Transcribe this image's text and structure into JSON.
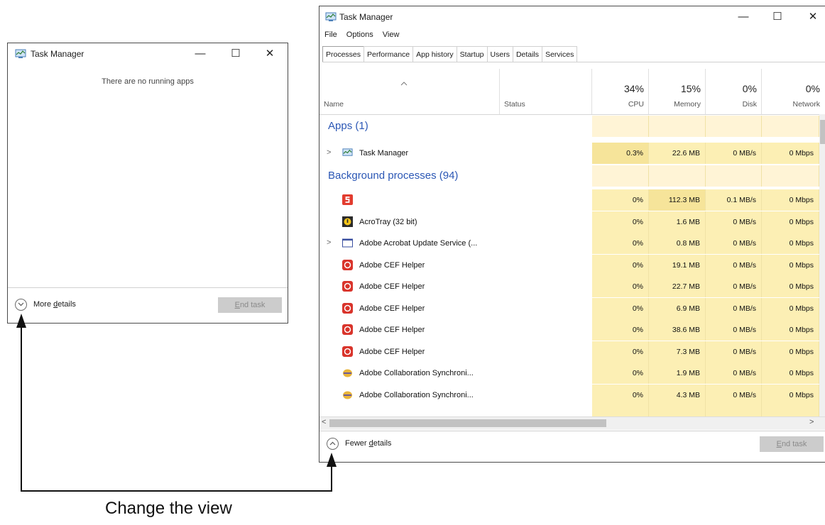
{
  "small_window": {
    "title": "Task Manager",
    "minimize": "—",
    "maximize": "☐",
    "close": "✕",
    "message": "There are no running apps",
    "more_details_prefix": "More ",
    "more_details_accel": "d",
    "more_details_suffix": "etails",
    "end_task_accel": "E",
    "end_task_suffix": "nd task"
  },
  "large_window": {
    "title": "Task Manager",
    "minimize": "—",
    "maximize": "☐",
    "close": "✕",
    "menu": [
      "File",
      "Options",
      "View"
    ],
    "tabs": [
      "Processes",
      "Performance",
      "App history",
      "Startup",
      "Users",
      "Details",
      "Services"
    ],
    "columns": {
      "name": "Name",
      "status": "Status",
      "cpu_pct": "34%",
      "cpu": "CPU",
      "memory_pct": "15%",
      "memory": "Memory",
      "disk_pct": "0%",
      "disk": "Disk",
      "network_pct": "0%",
      "network": "Network"
    },
    "apps_group": "Apps (1)",
    "bg_group": "Background processes (94)",
    "rows": [
      {
        "name": "Task Manager",
        "cpu": "0.3%",
        "memory": "22.6 MB",
        "disk": "0 MB/s",
        "network": "0 Mbps",
        "expand": ">",
        "icon": "task-manager-icon"
      },
      {
        "name": "",
        "cpu": "0%",
        "memory": "112.3 MB",
        "disk": "0.1 MB/s",
        "network": "0 Mbps",
        "expand": "",
        "icon": "red-s-icon"
      },
      {
        "name": "AcroTray (32 bit)",
        "cpu": "0%",
        "memory": "1.6 MB",
        "disk": "0 MB/s",
        "network": "0 Mbps",
        "expand": "",
        "icon": "acrotray-icon"
      },
      {
        "name": "Adobe Acrobat Update Service (...",
        "cpu": "0%",
        "memory": "0.8 MB",
        "disk": "0 MB/s",
        "network": "0 Mbps",
        "expand": ">",
        "icon": "service-window-icon"
      },
      {
        "name": "Adobe CEF Helper",
        "cpu": "0%",
        "memory": "19.1 MB",
        "disk": "0 MB/s",
        "network": "0 Mbps",
        "expand": "",
        "icon": "adobe-cef-icon"
      },
      {
        "name": "Adobe CEF Helper",
        "cpu": "0%",
        "memory": "22.7 MB",
        "disk": "0 MB/s",
        "network": "0 Mbps",
        "expand": "",
        "icon": "adobe-cef-icon"
      },
      {
        "name": "Adobe CEF Helper",
        "cpu": "0%",
        "memory": "6.9 MB",
        "disk": "0 MB/s",
        "network": "0 Mbps",
        "expand": "",
        "icon": "adobe-cef-icon"
      },
      {
        "name": "Adobe CEF Helper",
        "cpu": "0%",
        "memory": "38.6 MB",
        "disk": "0 MB/s",
        "network": "0 Mbps",
        "expand": "",
        "icon": "adobe-cef-icon"
      },
      {
        "name": "Adobe CEF Helper",
        "cpu": "0%",
        "memory": "7.3 MB",
        "disk": "0 MB/s",
        "network": "0 Mbps",
        "expand": "",
        "icon": "adobe-cef-icon"
      },
      {
        "name": "Adobe Collaboration Synchroni...",
        "cpu": "0%",
        "memory": "1.9 MB",
        "disk": "0 MB/s",
        "network": "0 Mbps",
        "expand": "",
        "icon": "adobe-sync-icon"
      },
      {
        "name": "Adobe Collaboration Synchroni...",
        "cpu": "0%",
        "memory": "4.3 MB",
        "disk": "0 MB/s",
        "network": "0 Mbps",
        "expand": "",
        "icon": "adobe-sync-icon"
      }
    ],
    "fewer_details_prefix": "Fewer ",
    "fewer_details_accel": "d",
    "fewer_details_suffix": "etails",
    "end_task_accel": "E",
    "end_task_suffix": "nd task",
    "scroll_left": "<",
    "scroll_right": ">"
  },
  "caption": "Change the view",
  "colors": {
    "heat_light": "#fff4d6",
    "heat_medium": "#fcefb4",
    "heat_strong": "#f6e49a",
    "group_blue": "#2b57b5"
  }
}
